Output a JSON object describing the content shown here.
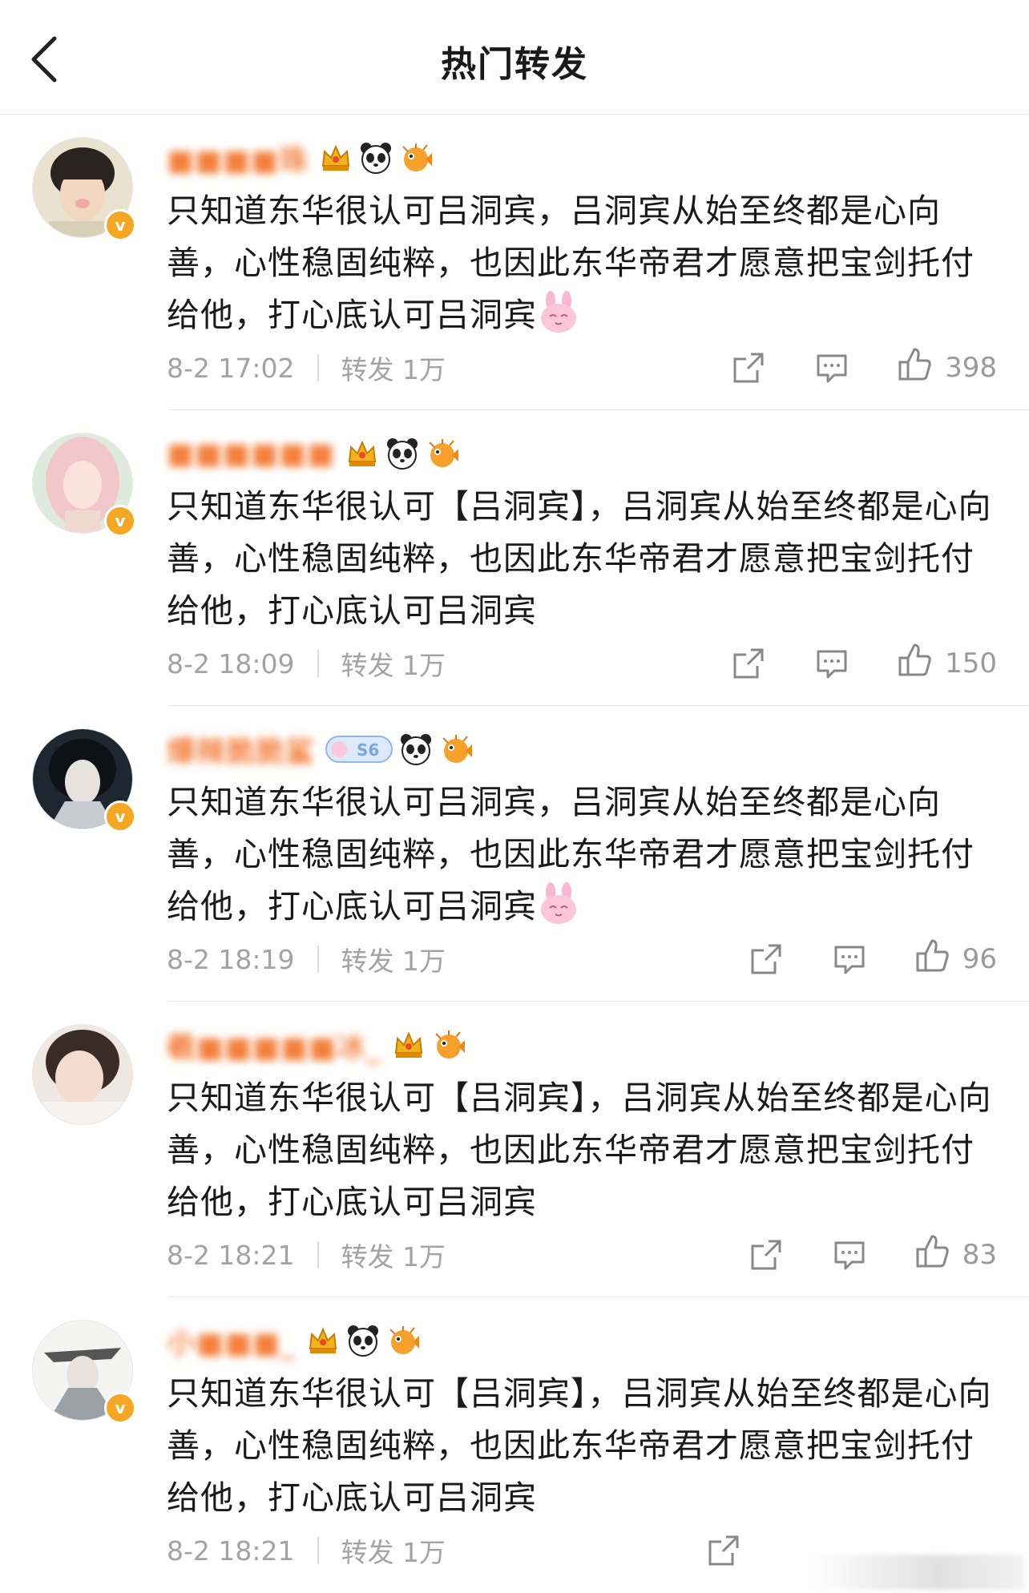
{
  "header": {
    "title": "热门转发",
    "back_icon": "chevron-left-icon"
  },
  "colors": {
    "username": "#f26a1b",
    "meta_text": "#a3a3a3",
    "verified_badge": "#f5a623",
    "divider": "#e8e8e8"
  },
  "posts": [
    {
      "username": "■■■■珠",
      "badges": [
        "crown-badge-icon",
        "panda-icon",
        "puffer-fish-icon"
      ],
      "content": "只知道东华很认可吕洞宾，吕洞宾从始至终都是心向善，心性稳固纯粹，也因此东华帝君才愿意把宝剑托付给他，打心底认可吕洞宾",
      "emoji": "pink-bunny-emoji",
      "date": "8-2 17:02",
      "repost_label": "转发 1万",
      "likes": "398"
    },
    {
      "username": "■■■■■■",
      "badges": [
        "crown-badge-icon",
        "panda-icon",
        "puffer-fish-icon"
      ],
      "content": "只知道东华很认可【吕洞宾】，吕洞宾从始至终都是心向善，心性稳固纯粹，也因此东华帝君才愿意把宝剑托付给他，打心底认可吕洞宾",
      "emoji": "",
      "date": "8-2 18:09",
      "repost_label": "转发 1万",
      "likes": "150"
    },
    {
      "username": "爆辣脆脆鲨",
      "badges": [
        "s6-badge-icon",
        "panda-icon",
        "puffer-fish-icon"
      ],
      "content": "只知道东华很认可吕洞宾，吕洞宾从始至终都是心向善，心性稳固纯粹，也因此东华帝君才愿意把宝剑托付给他，打心底认可吕洞宾",
      "emoji": "pink-bunny-emoji",
      "date": "8-2 18:19",
      "repost_label": "转发 1万",
      "likes": "96"
    },
    {
      "username": "羲■■■■■冰_",
      "badges": [
        "crown-badge-icon",
        "puffer-fish-icon"
      ],
      "content": "只知道东华很认可【吕洞宾】，吕洞宾从始至终都是心向善，心性稳固纯粹，也因此东华帝君才愿意把宝剑托付给他，打心底认可吕洞宾",
      "emoji": "",
      "date": "8-2 18:21",
      "repost_label": "转发 1万",
      "likes": "83"
    },
    {
      "username": "小■■■_",
      "badges": [
        "crown-badge-icon",
        "panda-icon",
        "puffer-fish-icon"
      ],
      "content": "只知道东华很认可【吕洞宾】，吕洞宾从始至终都是心向善，心性稳固纯粹，也因此东华帝君才愿意把宝剑托付给他，打心底认可吕洞宾",
      "emoji": "",
      "date": "8-2 18:21",
      "repost_label": "转发 1万",
      "likes": ""
    }
  ]
}
